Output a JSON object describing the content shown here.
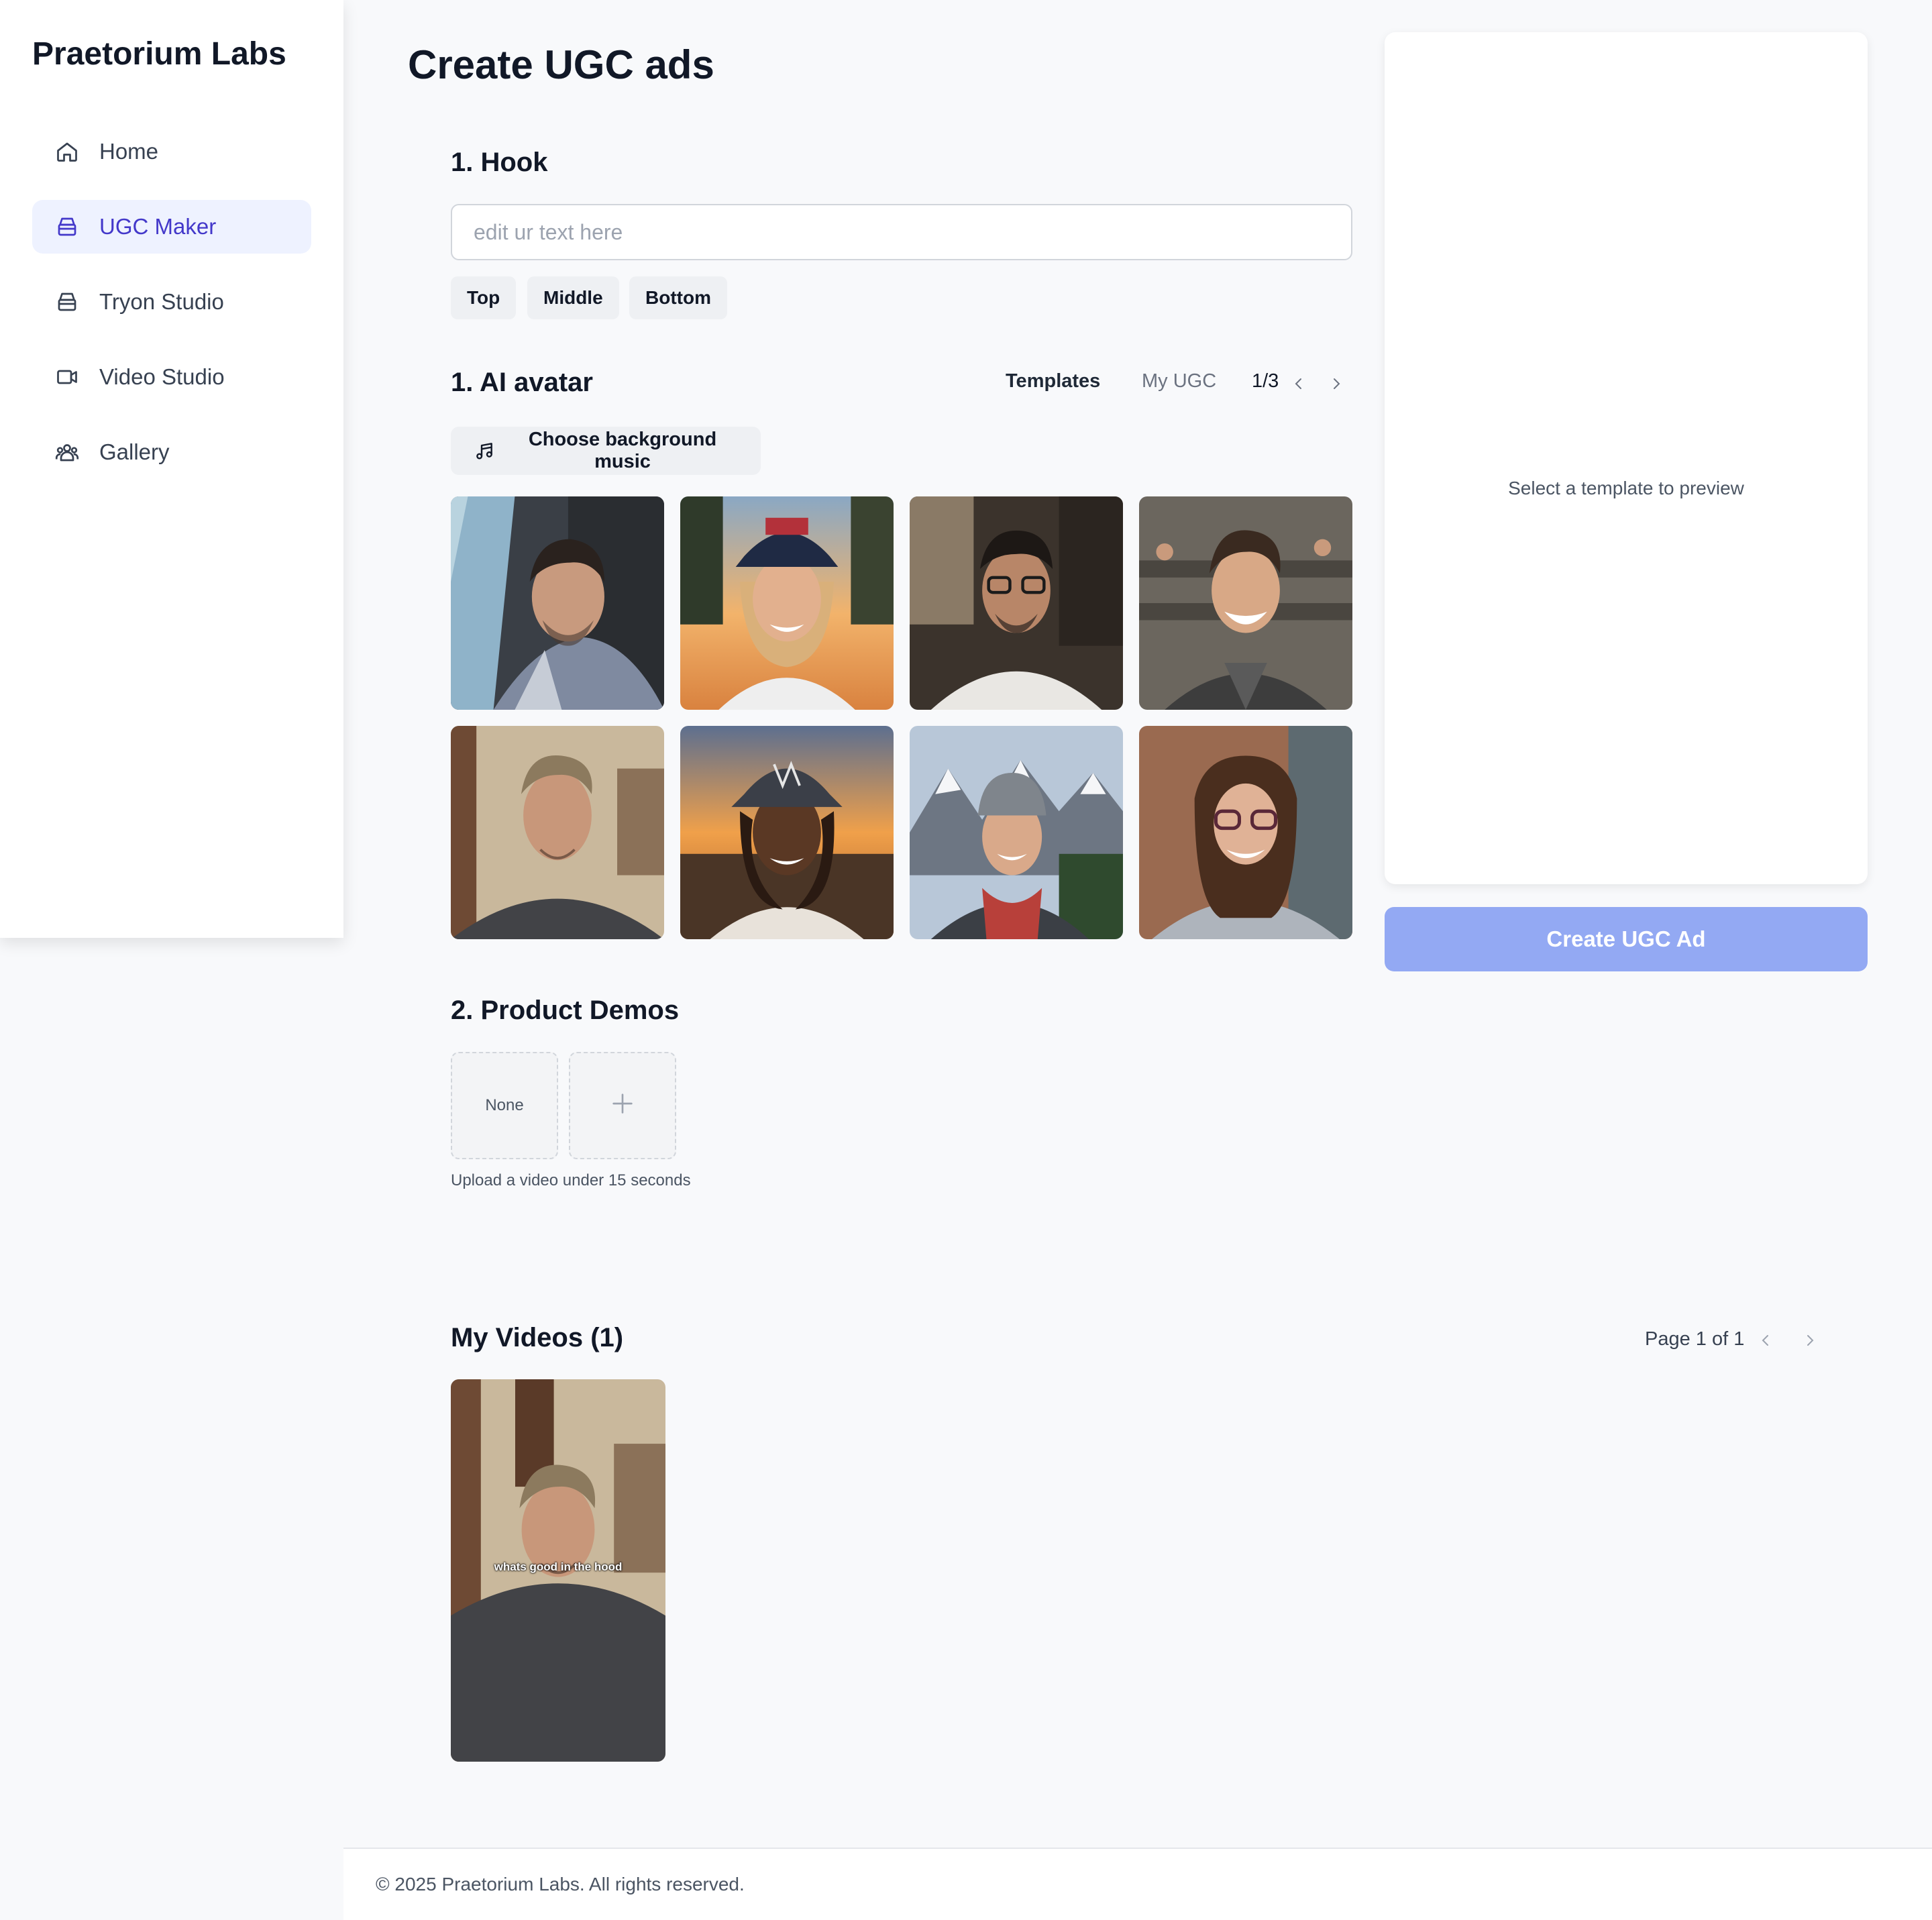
{
  "brand": "Praetorium Labs",
  "sidebar": {
    "items": [
      {
        "label": "Home",
        "icon": "home-icon",
        "active": false
      },
      {
        "label": "UGC Maker",
        "icon": "box-icon",
        "active": true
      },
      {
        "label": "Tryon Studio",
        "icon": "box-icon",
        "active": false
      },
      {
        "label": "Video Studio",
        "icon": "video-camera-icon",
        "active": false
      },
      {
        "label": "Gallery",
        "icon": "users-icon",
        "active": false
      }
    ]
  },
  "main": {
    "title": "Create UGC ads",
    "hook": {
      "title": "1. Hook",
      "placeholder": "edit ur text here",
      "positions": [
        "Top",
        "Middle",
        "Bottom"
      ]
    },
    "avatar": {
      "title": "1. AI avatar",
      "tabs": [
        "Templates",
        "My UGC"
      ],
      "active_tab": "Templates",
      "page": "1/3",
      "music_button": "Choose background music",
      "thumbnails": [
        "man-in-car-selfie",
        "woman-in-cap-at-sunset",
        "man-with-glasses-indoors",
        "smiling-man-in-lecture-hall",
        "man-in-grey-tshirt-at-home",
        "woman-in-ny-cap-at-sunset",
        "woman-hiker-in-mountains",
        "woman-with-glasses-in-hoodie"
      ]
    },
    "demos": {
      "title": "2. Product Demos",
      "none_label": "None",
      "note": "Upload a video under 15 seconds"
    },
    "videos": {
      "title": "My Videos (1)",
      "pager": "Page 1 of 1",
      "items": [
        {
          "caption": "whats good in the hood"
        }
      ]
    }
  },
  "preview": {
    "placeholder": "Select a template to preview",
    "create_button": "Create UGC Ad"
  },
  "footer": {
    "text": "© 2025 Praetorium Labs. All rights reserved."
  },
  "colors": {
    "accent": "#4338ca",
    "active_bg": "#eef2ff",
    "create_button": "#93a9f3"
  }
}
